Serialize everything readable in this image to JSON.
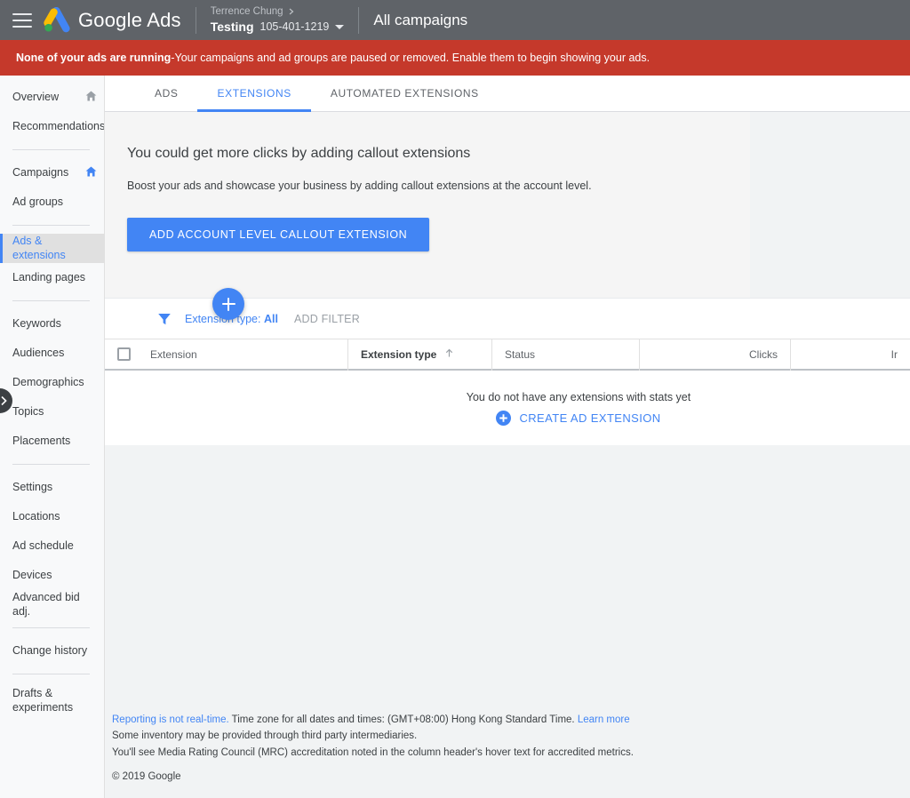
{
  "header": {
    "menu_icon": "hamburger-menu-icon",
    "brand": "Google Ads",
    "account_owner": "Terrence Chung",
    "account_name": "Testing",
    "account_id": "105-401-1219",
    "page_title": "All campaigns"
  },
  "alert": {
    "title": "None of your ads are running",
    "separator": " - ",
    "message": "Your campaigns and ad groups are paused or removed. Enable them to begin showing your ads."
  },
  "sidebar": {
    "items": [
      {
        "label": "Overview",
        "icon": "home-icon",
        "icon_active": false,
        "active": false
      },
      {
        "label": "Recommendations",
        "icon": null,
        "active": false
      },
      {
        "divider": true
      },
      {
        "label": "Campaigns",
        "icon": "home-icon",
        "icon_active": true,
        "active": false
      },
      {
        "label": "Ad groups",
        "icon": null,
        "active": false
      },
      {
        "divider": true
      },
      {
        "label": "Ads & extensions",
        "icon": null,
        "active": true
      },
      {
        "label": "Landing pages",
        "icon": null,
        "active": false
      },
      {
        "divider": true
      },
      {
        "label": "Keywords",
        "icon": null,
        "active": false
      },
      {
        "label": "Audiences",
        "icon": null,
        "active": false
      },
      {
        "label": "Demographics",
        "icon": null,
        "active": false
      },
      {
        "label": "Topics",
        "icon": null,
        "active": false
      },
      {
        "label": "Placements",
        "icon": null,
        "active": false
      },
      {
        "divider": true
      },
      {
        "label": "Settings",
        "icon": null,
        "active": false
      },
      {
        "label": "Locations",
        "icon": null,
        "active": false
      },
      {
        "label": "Ad schedule",
        "icon": null,
        "active": false
      },
      {
        "label": "Devices",
        "icon": null,
        "active": false
      },
      {
        "label": "Advanced bid adj.",
        "icon": null,
        "active": false
      },
      {
        "divider": true
      },
      {
        "label": "Change history",
        "icon": null,
        "active": false
      },
      {
        "divider": true
      },
      {
        "label": "Drafts & experiments",
        "icon": null,
        "active": false,
        "two_line": true
      }
    ],
    "collapse_icon": "chevron-right-icon"
  },
  "tabs": [
    {
      "label": "ADS",
      "active": false
    },
    {
      "label": "EXTENSIONS",
      "active": true
    },
    {
      "label": "AUTOMATED EXTENSIONS",
      "active": false
    }
  ],
  "promo": {
    "title": "You could get more clicks by adding callout extensions",
    "subtitle": "Boost your ads and showcase your business by adding callout extensions at the account level.",
    "button_label": "ADD ACCOUNT LEVEL CALLOUT EXTENSION"
  },
  "toolbar": {
    "add_icon": "plus-icon",
    "filter_icon": "funnel-icon",
    "filter_chip_label": "Extension type:",
    "filter_chip_value": "All",
    "add_filter_label": "ADD FILTER"
  },
  "table": {
    "select_all_icon": "checkbox-icon",
    "columns": [
      {
        "label": "Extension",
        "align": "left",
        "sorted": false
      },
      {
        "label": "Extension type",
        "align": "left",
        "sorted": true,
        "sort_icon": "sort-ascending-icon"
      },
      {
        "label": "Status",
        "align": "left",
        "sorted": false
      },
      {
        "label": "Clicks",
        "align": "right",
        "sorted": false
      },
      {
        "label": "Ir",
        "align": "right",
        "sorted": false
      }
    ],
    "empty_message": "You do not have any extensions with stats yet",
    "empty_cta_label": "CREATE AD EXTENSION",
    "empty_cta_icon": "plus-circle-icon"
  },
  "footer": {
    "link1": "Reporting is not real-time.",
    "line1": " Time zone for all dates and times: (GMT+08:00) Hong Kong Standard Time. ",
    "link2": "Learn more",
    "line2": "Some inventory may be provided through third party intermediaries.",
    "line3": "You'll see Media Rating Council (MRC) accreditation noted in the column header's hover text for accredited metrics.",
    "copyright": "© 2019 Google"
  },
  "colors": {
    "header_bg": "#5f6368",
    "alert_bg": "#c5392b",
    "accent_blue": "#4285f4",
    "sidebar_bg": "#f8f9fa",
    "page_bg": "#f1f3f4"
  }
}
